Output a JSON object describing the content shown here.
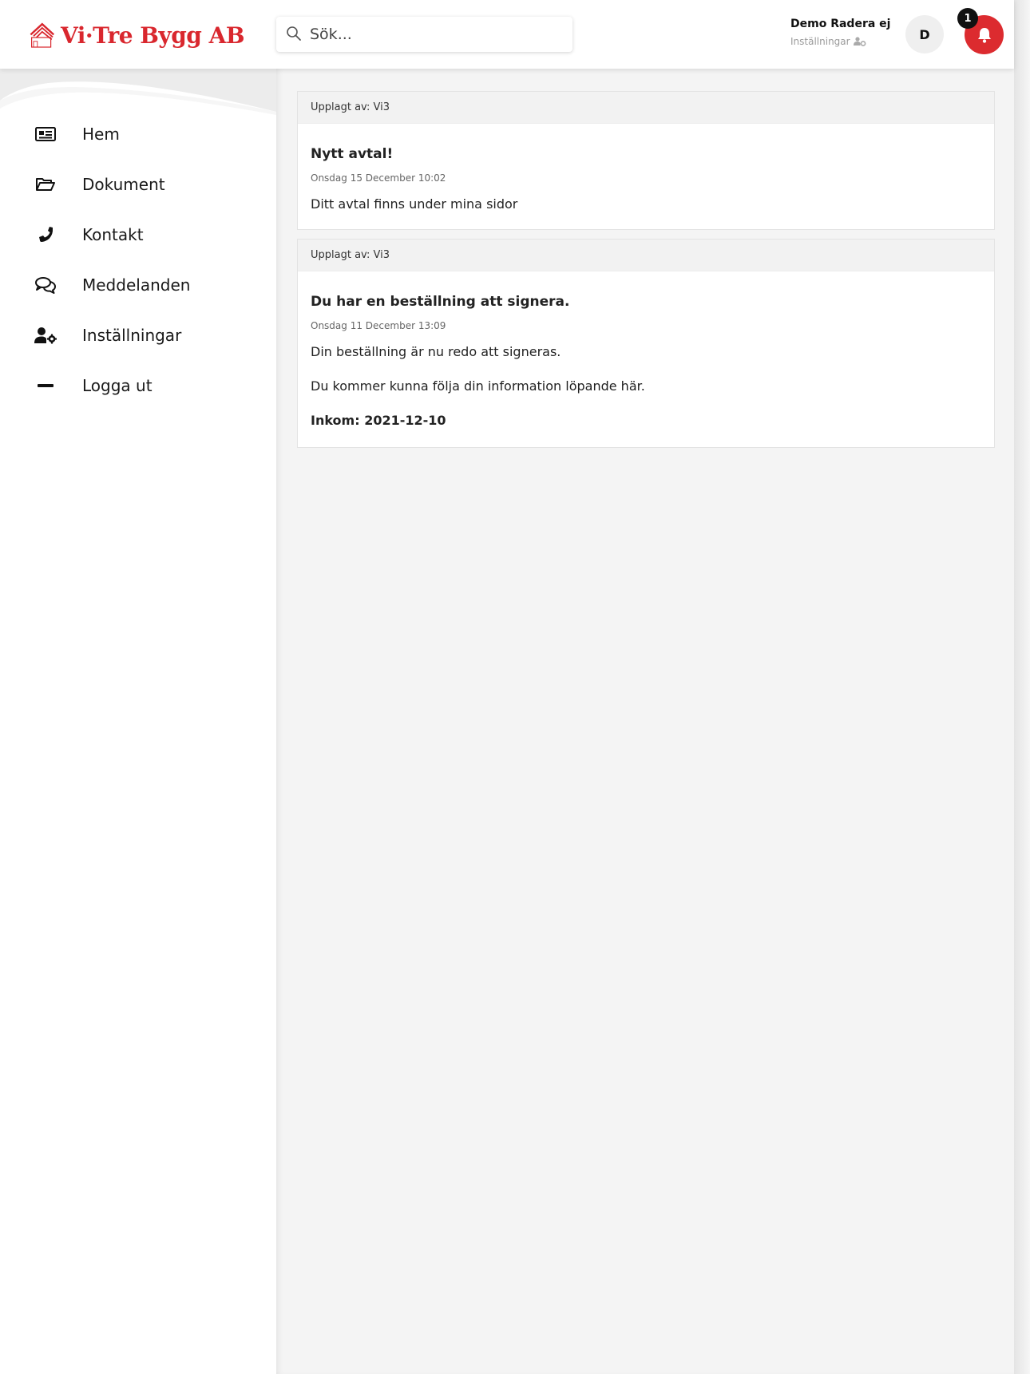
{
  "brand": {
    "name": "Vi·Tre Bygg AB",
    "color": "#d9272e"
  },
  "search": {
    "placeholder": "Sök..."
  },
  "user": {
    "name": "Demo Radera ej",
    "settings_label": "Inställningar",
    "avatar_initial": "D",
    "notification_count": "1"
  },
  "sidebar": {
    "items": [
      {
        "label": "Hem",
        "icon": "newspaper-icon"
      },
      {
        "label": "Dokument",
        "icon": "folder-open-icon"
      },
      {
        "label": "Kontakt",
        "icon": "phone-icon"
      },
      {
        "label": "Meddelanden",
        "icon": "chat-bubbles-icon"
      },
      {
        "label": "Inställningar",
        "icon": "user-gear-icon"
      },
      {
        "label": "Logga ut",
        "icon": "minus-icon"
      }
    ]
  },
  "posts": [
    {
      "posted_by": "Upplagt av: Vi3",
      "title": "Nytt avtal!",
      "date": "Onsdag 15 December 10:02",
      "paragraphs": [
        "Ditt avtal finns under mina sidor"
      ]
    },
    {
      "posted_by": "Upplagt av: Vi3",
      "title": "Du har en beställning att signera.",
      "date": "Onsdag 11 December 13:09",
      "paragraphs": [
        "Din beställning är nu redo att signeras.",
        "Du kommer kunna följa din information löpande här."
      ],
      "bold_line": "Inkom: 2021-12-10"
    }
  ],
  "colors": {
    "notification": "#dc2b2f",
    "main_bg": "#f4f4f4"
  }
}
